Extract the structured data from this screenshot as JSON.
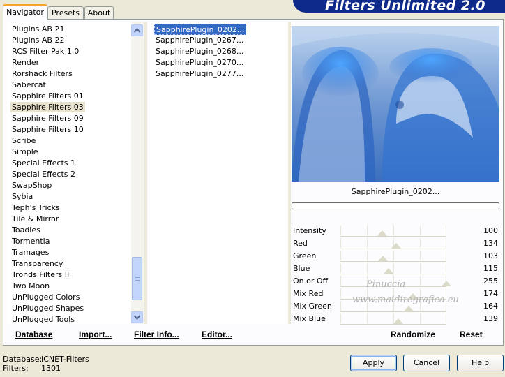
{
  "app": {
    "title": "Filters Unlimited 2.0"
  },
  "tabs": [
    "Navigator",
    "Presets",
    "About"
  ],
  "categories": [
    "Plugins AB 21",
    "Plugins AB 22",
    "RCS Filter Pak 1.0",
    "Render",
    "Rorshack Filters",
    "Sabercat",
    "Sapphire Filters 01",
    "Sapphire Filters 03",
    "Sapphire Filters 09",
    "Sapphire Filters 10",
    "Scribe",
    "Simple",
    "Special Effects 1",
    "Special Effects 2",
    "SwapShop",
    "Sybia",
    "Teph's Tricks",
    "Tile & Mirror",
    "Toadies",
    "Tormentia",
    "Tramages",
    "Transparency",
    "Tronds Filters II",
    "Two Moon",
    "UnPlugged Colors",
    "UnPlugged Shapes",
    "UnPlugged Tools"
  ],
  "selected_category_index": 7,
  "plugins": [
    "SapphirePlugin_0202...",
    "SapphirePlugin_0267...",
    "SapphirePlugin_0268...",
    "SapphirePlugin_0270...",
    "SapphirePlugin_0277..."
  ],
  "selected_plugin_index": 0,
  "preview": {
    "plugin_name": "SapphirePlugin_0202...",
    "progress": 0
  },
  "sliders": [
    {
      "label": "Intensity",
      "value": 100
    },
    {
      "label": "Red",
      "value": 134
    },
    {
      "label": "Green",
      "value": 103
    },
    {
      "label": "Blue",
      "value": 115
    },
    {
      "label": "On or Off",
      "value": 255
    },
    {
      "label": "Mix Red",
      "value": 174
    },
    {
      "label": "Mix Green",
      "value": 164
    },
    {
      "label": "Mix Blue",
      "value": 139
    }
  ],
  "watermark": {
    "line1": "Pinuccia",
    "line2": "www.maidiregrafica.eu"
  },
  "bottom_links": {
    "database": "Database",
    "import": "Import...",
    "filter_info": "Filter Info...",
    "editor": "Editor...",
    "randomize": "Randomize",
    "reset": "Reset"
  },
  "status": {
    "database_label": "Database:",
    "database_value": "ICNET-Filters",
    "filters_label": "Filters:",
    "filters_value": "1301"
  },
  "buttons": {
    "apply": "Apply",
    "cancel": "Cancel",
    "help": "Help"
  },
  "colors": {
    "banner": "#0e2a8a",
    "selection": "#316ac5",
    "tab_highlight": "#f3a52a"
  }
}
